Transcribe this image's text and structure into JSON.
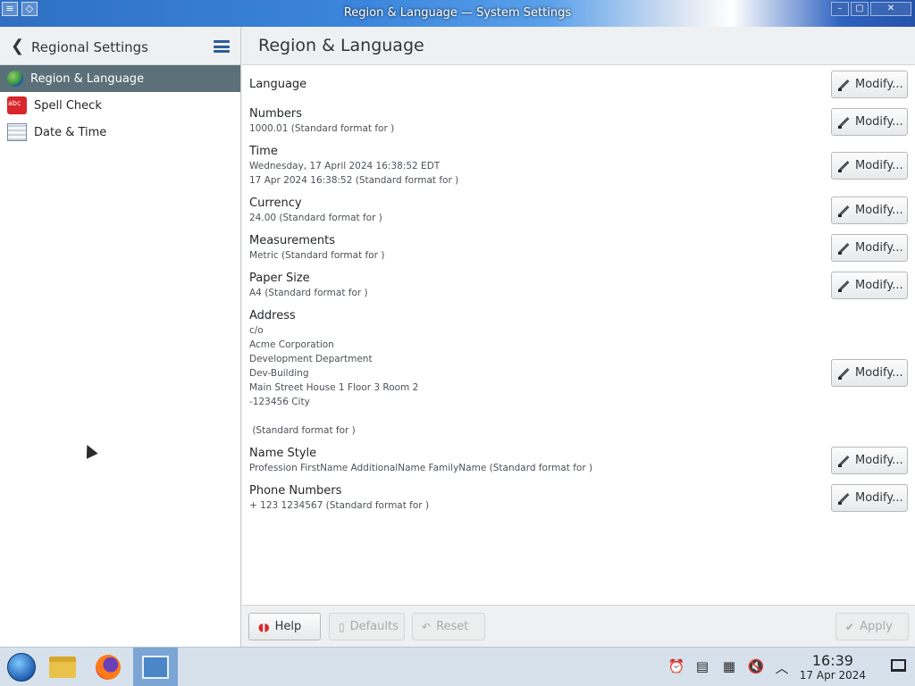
{
  "window": {
    "title": "Region & Language — System Settings",
    "controls": {
      "minimize": "–",
      "maximize": "▢",
      "close": "✕"
    }
  },
  "sidebar": {
    "header_title": "Regional Settings",
    "items": [
      {
        "label": "Region & Language",
        "icon": "globe-icon",
        "active": true
      },
      {
        "label": "Spell Check",
        "icon": "spell-check-icon",
        "active": false
      },
      {
        "label": "Date & Time",
        "icon": "calendar-icon",
        "active": false
      }
    ]
  },
  "main": {
    "title": "Region & Language",
    "modify_label": "Modify...",
    "settings": [
      {
        "label": "Language",
        "value": ""
      },
      {
        "label": "Numbers",
        "value": "1000.01 (Standard format for )"
      },
      {
        "label": "Time",
        "value": "Wednesday, 17 April 2024 16:38:52 EDT\n17 Apr 2024 16:38:52 (Standard format for )"
      },
      {
        "label": "Currency",
        "value": "24.00 (Standard format for )"
      },
      {
        "label": "Measurements",
        "value": "Metric (Standard format for )"
      },
      {
        "label": "Paper Size",
        "value": "A4 (Standard format for )"
      },
      {
        "label": "Address",
        "value": "c/o\nAcme Corporation\nDevelopment Department\nDev-Building\nMain Street House 1 Floor 3 Room 2\n-123456 City\n\n (Standard format for )"
      },
      {
        "label": "Name Style",
        "value": "Profession FirstName AdditionalName FamilyName (Standard format for )"
      },
      {
        "label": "Phone Numbers",
        "value": "+ 123 1234567 (Standard format for )"
      }
    ]
  },
  "footer": {
    "help": "Help",
    "defaults": "Defaults",
    "reset": "Reset",
    "apply": "Apply"
  },
  "taskbar": {
    "apps": [
      "start-menu-icon",
      "file-manager-icon",
      "firefox-icon",
      "system-settings-icon"
    ],
    "tray": [
      "notifications-icon",
      "clipboard-icon",
      "battery-icon",
      "volume-muted-icon",
      "expand-tray-icon"
    ],
    "time": "16:39",
    "date": "17 Apr 2024"
  },
  "colors": {
    "active_item": "#5b7079",
    "page_bg": "#eff0f1",
    "content_bg": "#ffffff",
    "taskbar_bg": "#d7e1ec"
  }
}
